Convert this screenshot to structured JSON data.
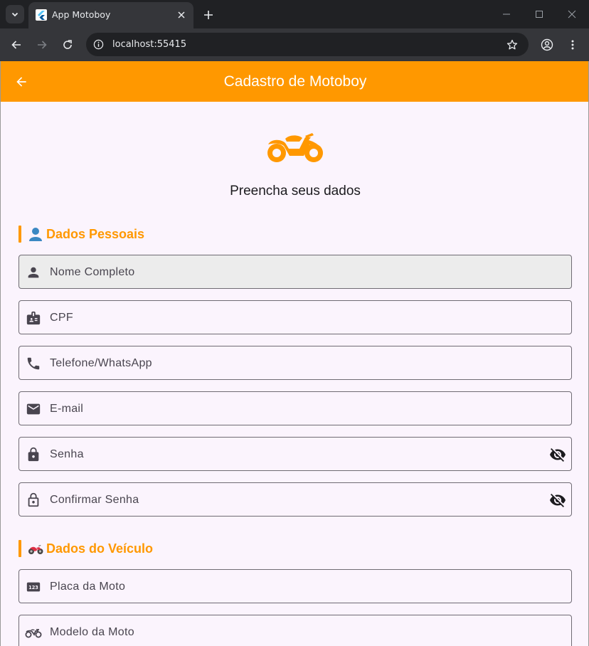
{
  "browser": {
    "tab_title": "App Motoboy",
    "url": "localhost:55415"
  },
  "app": {
    "title": "Cadastro de Motoboy",
    "subtitle": "Preencha seus dados",
    "accent_color": "#ff9800",
    "hero_icon": "motorcycle-icon"
  },
  "sections": {
    "personal": {
      "title": "Dados Pessoais",
      "emoji": "person-emoji"
    },
    "vehicle": {
      "title": "Dados do Veículo",
      "emoji": "motorcycle-emoji"
    }
  },
  "fields": {
    "nome": {
      "label": "Nome Completo",
      "icon": "person-icon"
    },
    "cpf": {
      "label": "CPF",
      "icon": "badge-icon"
    },
    "telefone": {
      "label": "Telefone/WhatsApp",
      "icon": "phone-icon"
    },
    "email": {
      "label": "E-mail",
      "icon": "mail-icon"
    },
    "senha": {
      "label": "Senha",
      "icon": "lock-icon",
      "suffix_icon": "visibility-off-icon"
    },
    "confirmar_senha": {
      "label": "Confirmar Senha",
      "icon": "lock-outline-icon",
      "suffix_icon": "visibility-off-icon"
    },
    "placa": {
      "label": "Placa da Moto",
      "icon": "pin-123-icon"
    },
    "modelo": {
      "label": "Modelo da Moto",
      "icon": "motorcycle-icon"
    }
  }
}
